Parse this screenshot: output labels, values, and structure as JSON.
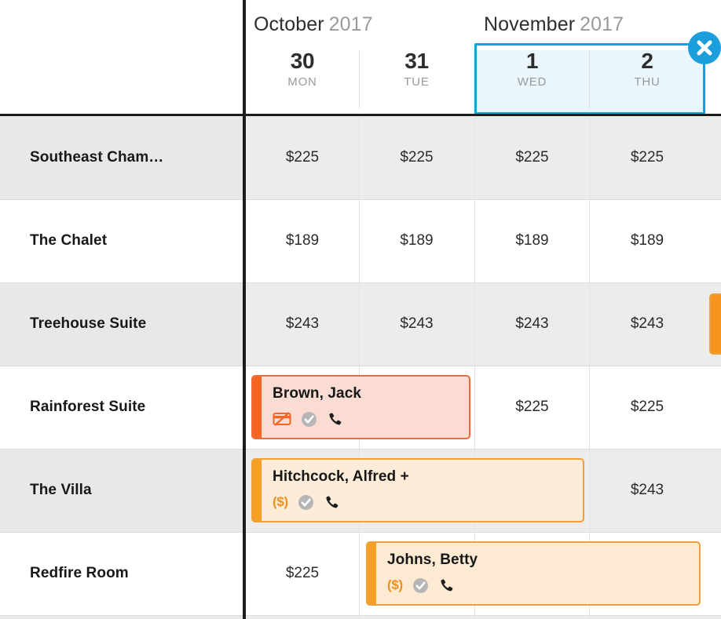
{
  "calendar": {
    "months": [
      {
        "name": "October",
        "year": "2017"
      },
      {
        "name": "November",
        "year": "2017"
      }
    ],
    "days": [
      {
        "num": "30",
        "dow": "MON",
        "selected": false
      },
      {
        "num": "31",
        "dow": "TUE",
        "selected": false
      },
      {
        "num": "1",
        "dow": "WED",
        "selected": true
      },
      {
        "num": "2",
        "dow": "THU",
        "selected": true
      }
    ],
    "close_button": {
      "icon": "close-icon",
      "label": "✕"
    },
    "accent_color": "#1a9fdc"
  },
  "rooms": [
    {
      "name": "Southeast Cham…",
      "rates": [
        "$225",
        "$225",
        "$225",
        "$225"
      ]
    },
    {
      "name": "The Chalet",
      "rates": [
        "$189",
        "$189",
        "$189",
        "$189"
      ]
    },
    {
      "name": "Treehouse Suite",
      "rates": [
        "$243",
        "$243",
        "$243",
        "$243"
      ]
    },
    {
      "name": "Rainforest Suite",
      "rates": [
        null,
        null,
        "$225",
        "$225"
      ]
    },
    {
      "name": "The Villa",
      "rates": [
        null,
        null,
        null,
        "$243"
      ]
    },
    {
      "name": "Redfire Room",
      "rates": [
        "$225",
        null,
        null,
        null
      ]
    }
  ],
  "bookings": [
    {
      "guest": "Brown, Jack",
      "row": 3,
      "status_color": "#f26522",
      "fill_color": "#fbdcd2",
      "border_color": "#ef6a36",
      "icons": [
        "no-credit-card-icon",
        "confirmed-check-icon",
        "phone-icon"
      ],
      "money_label": null
    },
    {
      "guest": "Hitchcock, Alfred +",
      "row": 4,
      "status_color": "#f59f24",
      "fill_color": "#fdecd7",
      "border_color": "#f0a038",
      "icons": [
        "balance-due-icon",
        "confirmed-check-icon",
        "phone-icon"
      ],
      "money_label": "($)"
    },
    {
      "guest": "Johns, Betty",
      "row": 5,
      "status_color": "#f59f24",
      "fill_color": "#fdead3",
      "border_color": "#f0a038",
      "icons": [
        "balance-due-icon",
        "confirmed-check-icon",
        "phone-icon"
      ],
      "money_label": "($)"
    },
    {
      "guest": "",
      "row": 2,
      "status_color": "#f59f24",
      "fill_color": "#f7941e",
      "border_color": "#f0a038",
      "icons": [],
      "money_label": null
    }
  ]
}
